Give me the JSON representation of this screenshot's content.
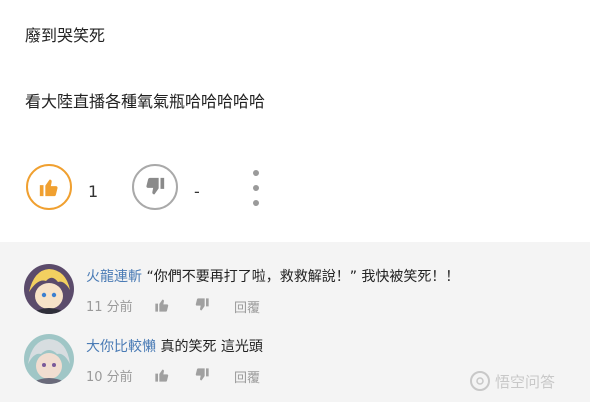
{
  "post": {
    "line1": "廢到哭笑死",
    "line2": "看大陸直播各種氧氣瓶哈哈哈哈哈",
    "upvote_count": "1",
    "downvote_count": "-"
  },
  "icons": {
    "upvote": "thumbs-up-icon",
    "downvote": "thumbs-down-icon",
    "more": "more-vertical-icon",
    "watermark_logo": "logo-icon"
  },
  "colors": {
    "upvote_ring": "#f0a030",
    "downvote_ring": "#a9a9a9",
    "username": "#4a7bb5",
    "comments_bg": "#f4f4f4"
  },
  "comments": [
    {
      "user": "火龍連斬",
      "text": "“你們不要再打了啦，救救解說！” 我快被笑死！！",
      "time": "11 分前",
      "reply": "回覆"
    },
    {
      "user": "大你比較懶",
      "text": "真的笑死 這光頭",
      "time": "10 分前",
      "reply": "回覆"
    }
  ],
  "watermark": {
    "text": "悟空问答"
  }
}
